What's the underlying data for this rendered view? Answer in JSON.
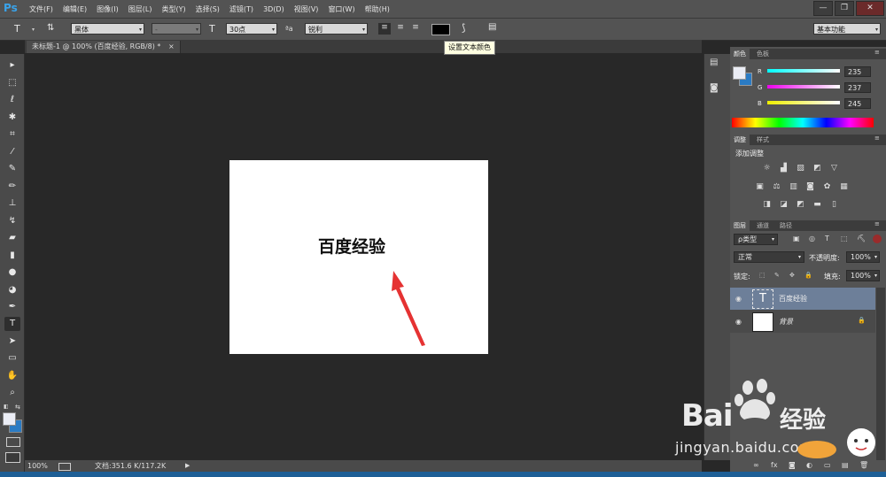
{
  "app": {
    "logo": "Ps",
    "menu": [
      "文件(F)",
      "编辑(E)",
      "图像(I)",
      "图层(L)",
      "类型(Y)",
      "选择(S)",
      "滤镜(T)",
      "3D(D)",
      "视图(V)",
      "窗口(W)",
      "帮助(H)"
    ],
    "window_controls": [
      "—",
      "❐",
      "✕"
    ]
  },
  "options": {
    "tool_glyph": "T",
    "orient_glyph": "⇅",
    "font_family": "黑体",
    "font_style": "-",
    "size_glyph": "T",
    "font_size": "30点",
    "aa_glyph": "ªa",
    "antialias": "锐利",
    "align_glyphs": [
      "≡",
      "≡",
      "≡"
    ],
    "warp_glyph": "⟆",
    "panel_glyph": "▤",
    "text_color": "#000000",
    "workspace": "基本功能",
    "tooltip": "设置文本颜色"
  },
  "document": {
    "tab_title": "未标题-1 @ 100% (百度经验, RGB/8) *",
    "tab_close": "×",
    "canvas_text": "百度经验",
    "zoom": "100%",
    "doc_info": "文档:351.6 K/117.2K",
    "status_arrow": "▶"
  },
  "tools": [
    {
      "name": "move-tool-icon",
      "glyph": "▸"
    },
    {
      "name": "marquee-tool-icon",
      "glyph": "⬚"
    },
    {
      "name": "lasso-tool-icon",
      "glyph": "ℓ"
    },
    {
      "name": "magic-wand-tool-icon",
      "glyph": "✱"
    },
    {
      "name": "crop-tool-icon",
      "glyph": "⌗"
    },
    {
      "name": "eyedropper-tool-icon",
      "glyph": "⁄"
    },
    {
      "name": "healing-brush-tool-icon",
      "glyph": "✎"
    },
    {
      "name": "brush-tool-icon",
      "glyph": "✏"
    },
    {
      "name": "stamp-tool-icon",
      "glyph": "⊥"
    },
    {
      "name": "history-brush-tool-icon",
      "glyph": "↯"
    },
    {
      "name": "eraser-tool-icon",
      "glyph": "▰"
    },
    {
      "name": "gradient-tool-icon",
      "glyph": "▮"
    },
    {
      "name": "blur-tool-icon",
      "glyph": "●"
    },
    {
      "name": "dodge-tool-icon",
      "glyph": "◕"
    },
    {
      "name": "pen-tool-icon",
      "glyph": "✒"
    },
    {
      "name": "type-tool-icon",
      "glyph": "T"
    },
    {
      "name": "path-selection-tool-icon",
      "glyph": "➤"
    },
    {
      "name": "shape-tool-icon",
      "glyph": "▭"
    },
    {
      "name": "hand-tool-icon",
      "glyph": "✋"
    },
    {
      "name": "zoom-tool-icon",
      "glyph": "⌕"
    }
  ],
  "colors": {
    "tabs": [
      "颜色",
      "色板"
    ],
    "r_label": "R",
    "g_label": "G",
    "b_label": "B",
    "r": "235",
    "g": "237",
    "b": "245",
    "fg": "#ebedf5",
    "bg": "#2a7bc4"
  },
  "adjustments": {
    "tabs": [
      "调整",
      "样式"
    ],
    "title": "添加调整",
    "row1": [
      "☼",
      "▟",
      "▨",
      "◩",
      "▽"
    ],
    "row2": [
      "▣",
      "⚖",
      "▥",
      "◙",
      "✿",
      "▦"
    ],
    "row3": [
      "◨",
      "◪",
      "◩",
      "▬",
      "▯"
    ]
  },
  "layers": {
    "tabs": [
      "图层",
      "通道",
      "路径"
    ],
    "filter": "ρ类型",
    "filter_icons": [
      "▣",
      "◎",
      "T",
      "⬚",
      "⛏"
    ],
    "blend": "正常",
    "opacity_label": "不透明度:",
    "opacity": "100%",
    "lock_label": "锁定:",
    "lock_icons": [
      "⬚",
      "✎",
      "✥",
      "🔒"
    ],
    "fill_label": "填充:",
    "fill": "100%",
    "items": [
      {
        "name": "百度经验",
        "type_glyph": "T",
        "selected": true
      },
      {
        "name": "背景",
        "lock_glyph": "🔒",
        "selected": false
      }
    ],
    "eye_glyph": "◉",
    "bottom_icons": [
      "∞",
      "fx",
      "◙",
      "◐",
      "▭",
      "▤",
      "🗑"
    ]
  },
  "watermark": {
    "brand": "Bai",
    "brand2": "经验",
    "url": "jingyan.baidu.com"
  }
}
